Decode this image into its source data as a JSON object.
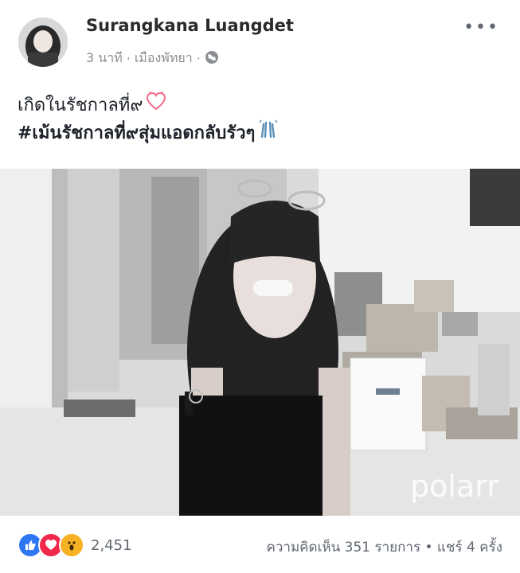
{
  "post": {
    "author": "Surangkana Luangdet",
    "time": "3 นาที",
    "separator": "·",
    "location": "เมืองพัทยา",
    "caption_line1": "เกิดในรัชกาลที่๙",
    "caption_line2": "#เม้นรัชกาลที่๙สุ่มแอดกลับรัวๆ",
    "photo_watermark": "polarr"
  },
  "footer": {
    "reactions": [
      "like",
      "love",
      "wow"
    ],
    "reaction_count": "2,451",
    "comments_shares": "ความคิดเห็น 351 รายการ • แชร์ 4 ครั้ง"
  },
  "colors": {
    "like": "#2f77f2",
    "love": "#f0284a",
    "wow": "#f7b125",
    "text_secondary": "#606770"
  },
  "icons": {
    "more": "ellipsis-icon",
    "privacy": "globe-icon",
    "heart_emoji": "heart-emoji-icon",
    "hands_emoji": "raised-hands-emoji-icon"
  }
}
